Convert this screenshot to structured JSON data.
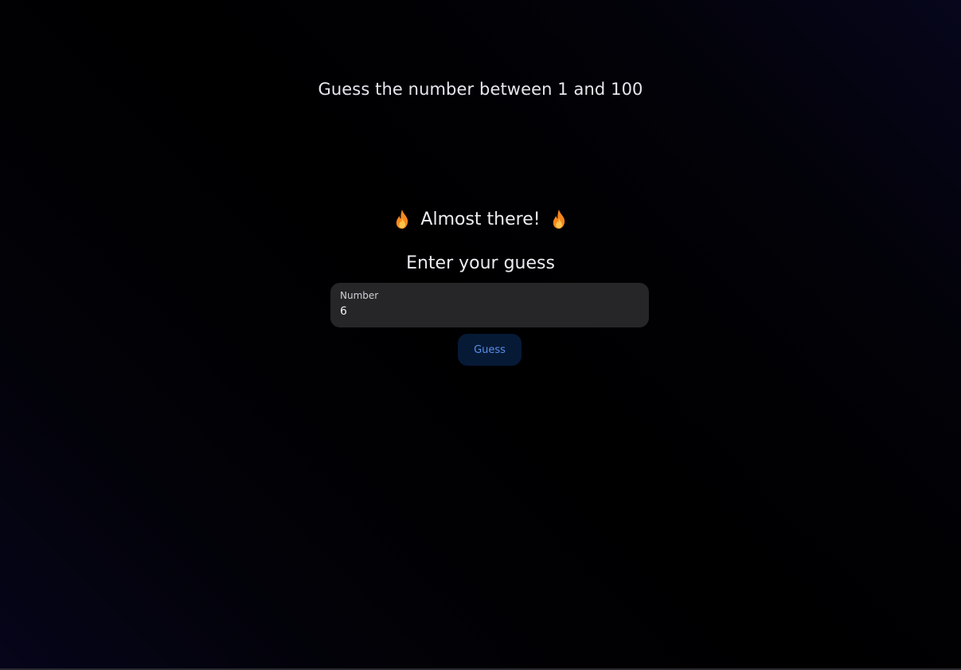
{
  "header": {
    "title": "Guess the number between 1 and 100"
  },
  "feedback": {
    "message": "Almost there!",
    "icon": "fire-icon",
    "icon_color": "#f6871f"
  },
  "form": {
    "prompt": "Enter your guess",
    "input_label": "Number",
    "input_value": "6",
    "submit_label": "Guess"
  },
  "colors": {
    "button_background": "#061a36",
    "button_text": "#5b8fe6",
    "field_background": "#262628"
  }
}
